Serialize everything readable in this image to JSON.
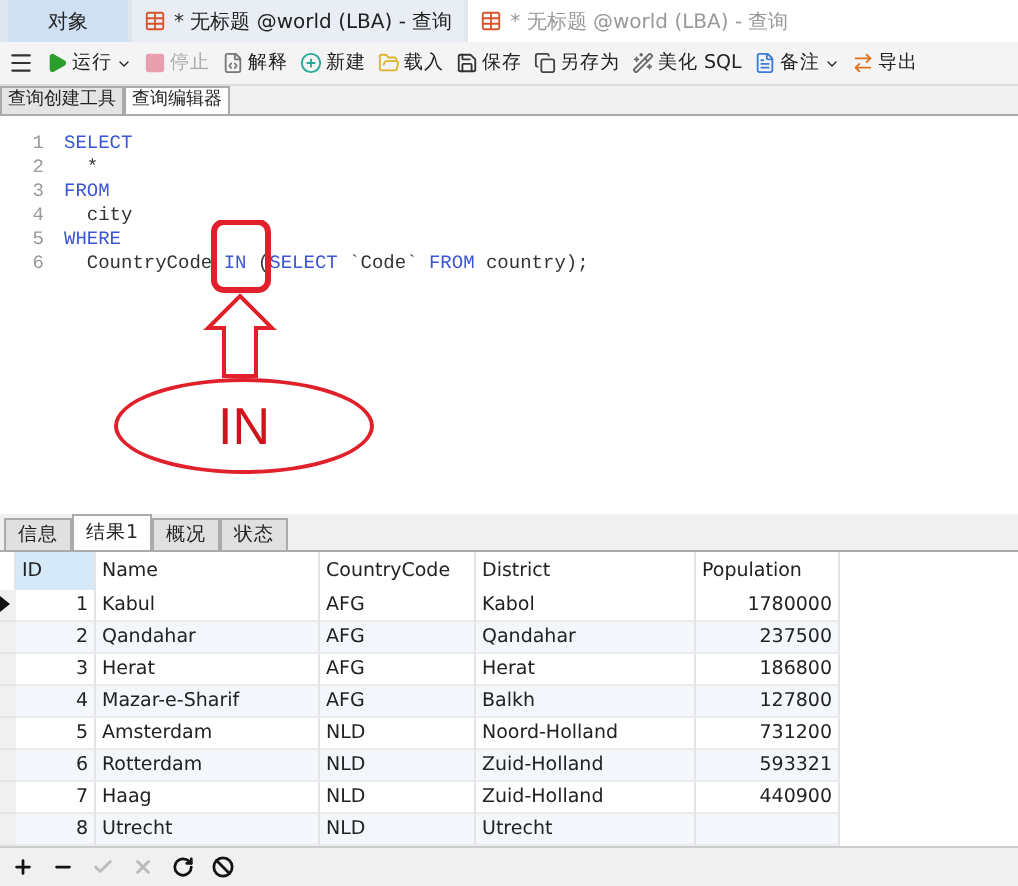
{
  "window_tabs": [
    {
      "label": "对象",
      "kind": "plain",
      "selected": false
    },
    {
      "label": "* 无标题 @world (LBA) - 查询",
      "kind": "query",
      "selected": true
    },
    {
      "label": "* 无标题 @world (LBA) - 查询",
      "kind": "query",
      "selected": false
    }
  ],
  "toolbar": [
    {
      "kind": "menu",
      "disabled": false
    },
    {
      "kind": "run",
      "label": "运行",
      "dropdown": true,
      "disabled": false
    },
    {
      "kind": "stop",
      "label": "停止",
      "disabled": true
    },
    {
      "kind": "explain",
      "label": "解释",
      "disabled": false
    },
    {
      "kind": "new",
      "label": "新建",
      "disabled": false
    },
    {
      "kind": "load",
      "label": "载入",
      "disabled": false
    },
    {
      "kind": "save",
      "label": "保存",
      "disabled": false
    },
    {
      "kind": "saveas",
      "label": "另存为",
      "disabled": false
    },
    {
      "kind": "beautify",
      "label": "美化 SQL",
      "disabled": false
    },
    {
      "kind": "note",
      "label": "备注",
      "dropdown": true,
      "disabled": false
    },
    {
      "kind": "export",
      "label": "导出",
      "disabled": false
    }
  ],
  "editor_tabs": [
    {
      "label": "查询创建工具",
      "selected": false
    },
    {
      "label": "查询编辑器",
      "selected": true
    }
  ],
  "code_lines": [
    {
      "number": "1",
      "tokens": [
        {
          "kind": "keyword",
          "text": "SELECT"
        }
      ]
    },
    {
      "number": "2",
      "tokens": [
        {
          "kind": "plain",
          "text": "  *"
        }
      ]
    },
    {
      "number": "3",
      "tokens": [
        {
          "kind": "keyword",
          "text": "FROM"
        }
      ]
    },
    {
      "number": "4",
      "tokens": [
        {
          "kind": "plain",
          "text": "  city"
        }
      ]
    },
    {
      "number": "5",
      "tokens": [
        {
          "kind": "keyword",
          "text": "WHERE"
        }
      ]
    },
    {
      "number": "6",
      "tokens": [
        {
          "kind": "plain",
          "text": "  CountryCode "
        },
        {
          "kind": "keyword",
          "text": "IN"
        },
        {
          "kind": "plain",
          "text": " ("
        },
        {
          "kind": "keyword",
          "text": "SELECT"
        },
        {
          "kind": "plain",
          "text": " `Code` "
        },
        {
          "kind": "keyword",
          "text": "FROM"
        },
        {
          "kind": "plain",
          "text": " country);"
        }
      ]
    }
  ],
  "annotation": {
    "label": "IN"
  },
  "result_tabs": [
    {
      "label": "信息",
      "selected": false
    },
    {
      "label": "结果1",
      "selected": true
    },
    {
      "label": "概况",
      "selected": false
    },
    {
      "label": "状态",
      "selected": false
    }
  ],
  "table": {
    "columns": [
      "ID",
      "Name",
      "CountryCode",
      "District",
      "Population"
    ],
    "rows": [
      {
        "cells": [
          "1",
          "Kabul",
          "AFG",
          "Kabol",
          "1780000"
        ],
        "selected": true
      },
      {
        "cells": [
          "2",
          "Qandahar",
          "AFG",
          "Qandahar",
          "237500"
        ],
        "selected": false
      },
      {
        "cells": [
          "3",
          "Herat",
          "AFG",
          "Herat",
          "186800"
        ],
        "selected": false
      },
      {
        "cells": [
          "4",
          "Mazar-e-Sharif",
          "AFG",
          "Balkh",
          "127800"
        ],
        "selected": false
      },
      {
        "cells": [
          "5",
          "Amsterdam",
          "NLD",
          "Noord-Holland",
          "731200"
        ],
        "selected": false
      },
      {
        "cells": [
          "6",
          "Rotterdam",
          "NLD",
          "Zuid-Holland",
          "593321"
        ],
        "selected": false
      },
      {
        "cells": [
          "7",
          "Haag",
          "NLD",
          "Zuid-Holland",
          "440900"
        ],
        "selected": false
      },
      {
        "cells": [
          "8",
          "Utrecht",
          "NLD",
          "Utrecht"
        ],
        "selected": false
      }
    ]
  },
  "grid_tools": [
    {
      "kind": "add",
      "disabled": false
    },
    {
      "kind": "remove",
      "disabled": false
    },
    {
      "kind": "apply",
      "disabled": true
    },
    {
      "kind": "discard",
      "disabled": true
    },
    {
      "kind": "refresh",
      "disabled": false
    },
    {
      "kind": "stop",
      "disabled": false
    }
  ]
}
